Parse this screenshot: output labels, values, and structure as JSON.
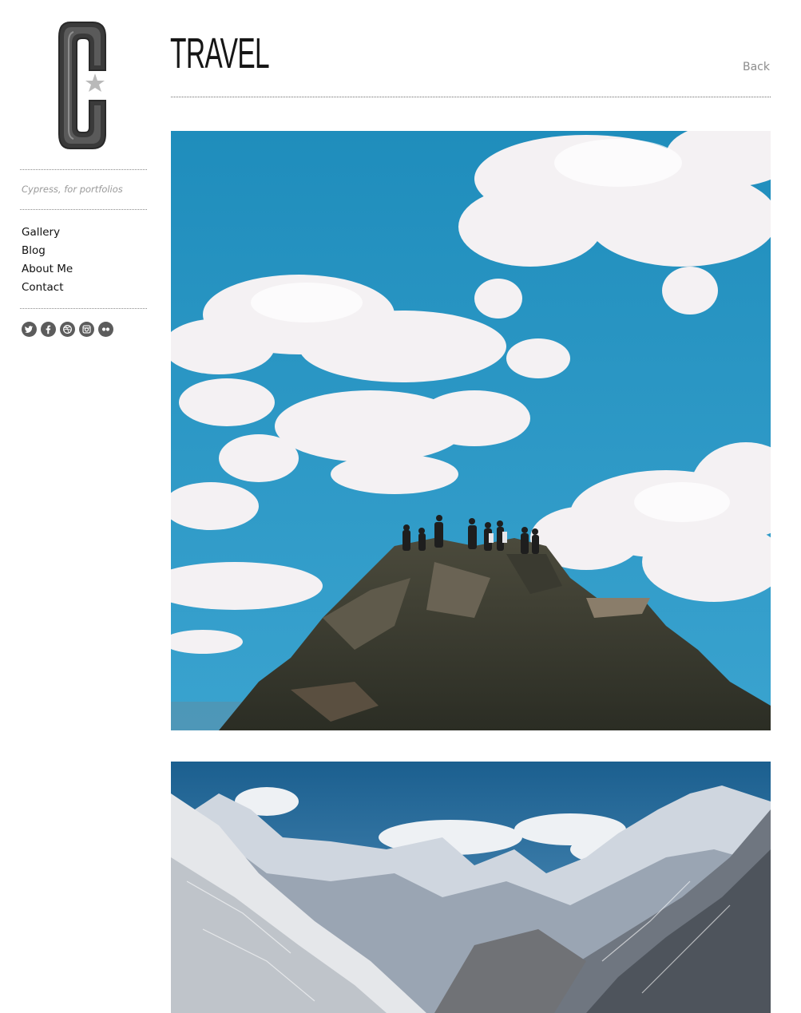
{
  "sidebar": {
    "logo_letter": "C",
    "tagline": "Cypress, for portfolios",
    "nav": [
      {
        "label": "Gallery"
      },
      {
        "label": "Blog"
      },
      {
        "label": "About Me"
      },
      {
        "label": "Contact"
      }
    ],
    "social": [
      {
        "icon": "twitter-icon"
      },
      {
        "icon": "facebook-icon"
      },
      {
        "icon": "dribbble-icon"
      },
      {
        "icon": "instagram-icon"
      },
      {
        "icon": "flickr-icon"
      }
    ]
  },
  "header": {
    "title": "TRAVEL",
    "back_label": "Back"
  },
  "colors": {
    "sky": "#2a8fb9",
    "text": "#111111",
    "muted": "#8c8c8c",
    "icon_bg": "#5c5c5c"
  }
}
